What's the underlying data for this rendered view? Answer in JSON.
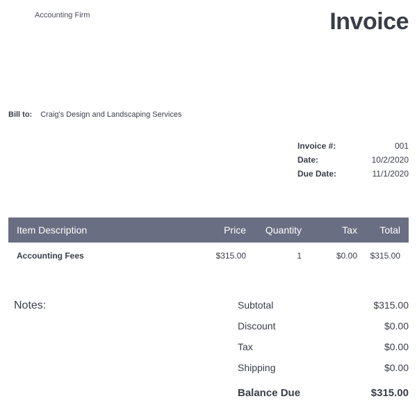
{
  "header": {
    "firm": "Accounting Firm",
    "title": "Invoice"
  },
  "bill_to": {
    "label": "Bill to:",
    "value": "Craig's Design and Landscaping Services"
  },
  "meta": {
    "invoice_number": {
      "label": "Invoice #:",
      "value": "001"
    },
    "date": {
      "label": "Date:",
      "value": "10/2/2020"
    },
    "due_date": {
      "label": "Due Date:",
      "value": "11/1/2020"
    }
  },
  "table": {
    "headers": {
      "description": "Item Description",
      "price": "Price",
      "quantity": "Quantity",
      "tax": "Tax",
      "total": "Total"
    },
    "rows": [
      {
        "description": "Accounting Fees",
        "price": "$315.00",
        "quantity": "1",
        "tax": "$0.00",
        "total": "$315.00"
      }
    ]
  },
  "notes": {
    "label": "Notes:"
  },
  "totals": {
    "subtotal": {
      "label": "Subtotal",
      "value": "$315.00"
    },
    "discount": {
      "label": "Discount",
      "value": "$0.00"
    },
    "tax": {
      "label": "Tax",
      "value": "$0.00"
    },
    "shipping": {
      "label": "Shipping",
      "value": "$0.00"
    },
    "balance": {
      "label": "Balance Due",
      "value": "$315.00"
    }
  }
}
